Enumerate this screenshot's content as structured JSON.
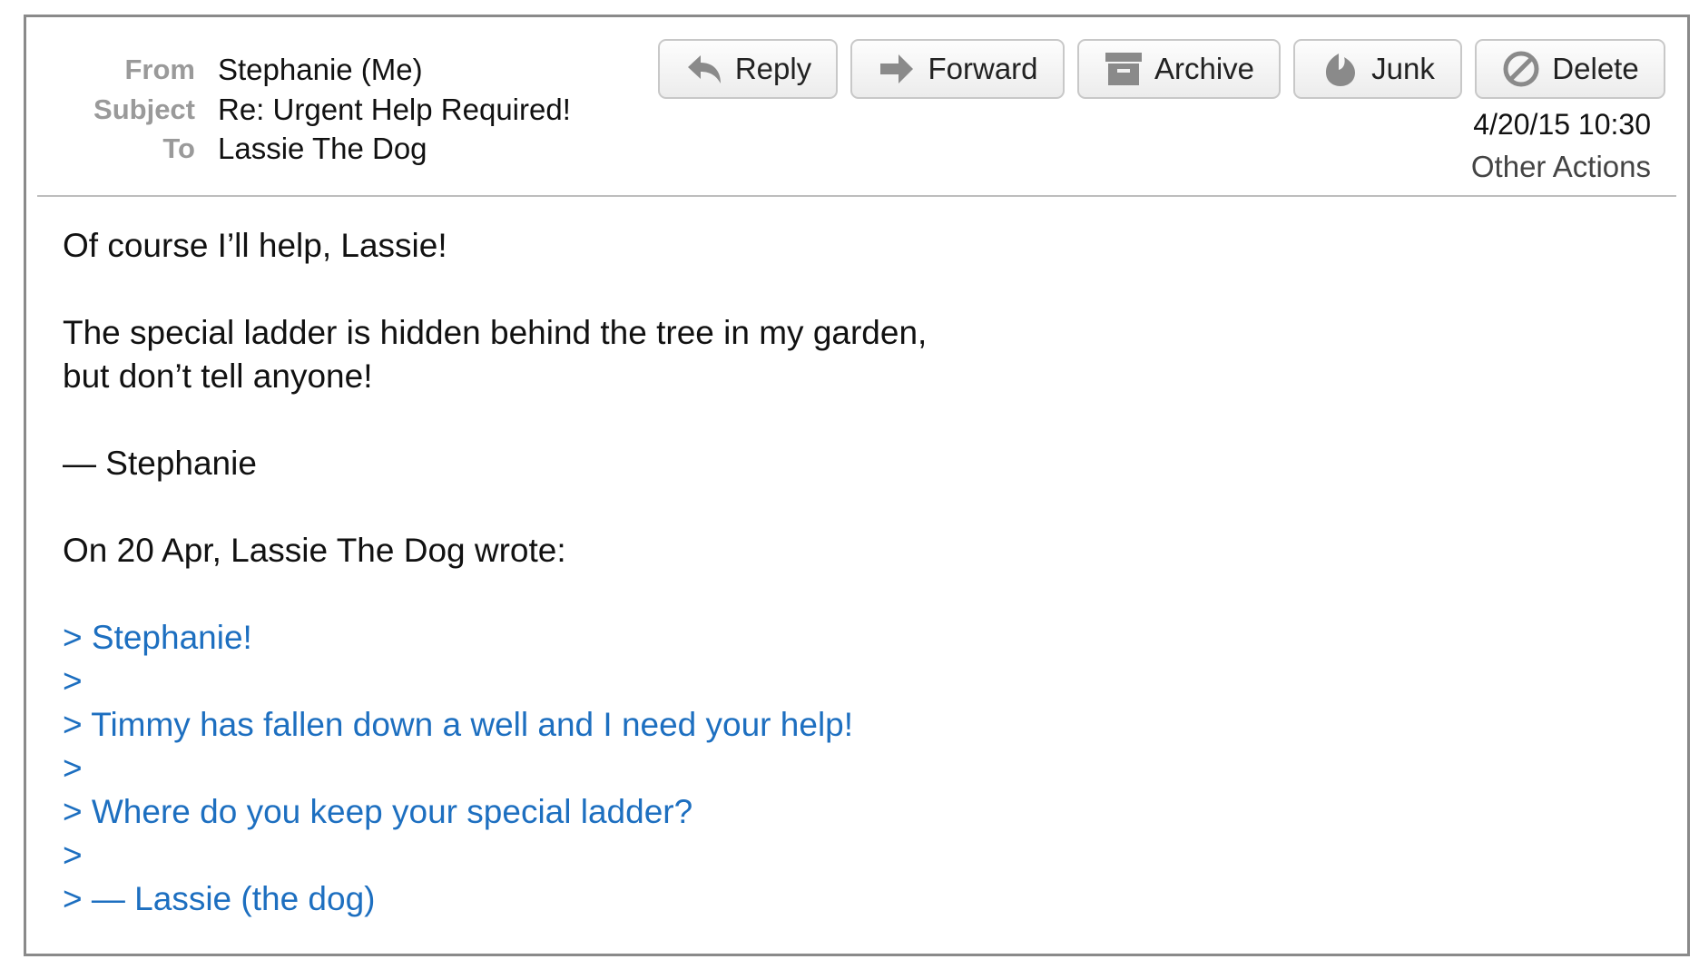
{
  "header": {
    "from_label": "From",
    "from_value": "Stephanie (Me)",
    "subject_label": "Subject",
    "subject_value": "Re: Urgent Help Required!",
    "to_label": "To",
    "to_value": "Lassie The Dog",
    "date": "4/20/15 10:30",
    "other_actions": "Other Actions"
  },
  "toolbar": {
    "reply": "Reply",
    "forward": "Forward",
    "archive": "Archive",
    "junk": "Junk",
    "delete": "Delete"
  },
  "message": {
    "line1": "Of course I’ll help, Lassie!",
    "line2": "The special ladder is hidden behind the tree in my garden,",
    "line3": "but don’t tell anyone!",
    "signature": "— Stephanie",
    "attribution": "On 20 Apr, Lassie The Dog wrote:",
    "quoted": [
      "> Stephanie!",
      ">",
      "> Timmy has fallen down a well and I need your help!",
      ">",
      "> Where do you keep your special ladder?",
      ">",
      "> — Lassie (the dog)"
    ]
  },
  "colors": {
    "quote": "#1d6fc0",
    "label": "#9a9a9a",
    "border": "#8a8a8a"
  },
  "icons": [
    "reply-icon",
    "forward-icon",
    "archive-icon",
    "junk-icon",
    "delete-icon"
  ]
}
